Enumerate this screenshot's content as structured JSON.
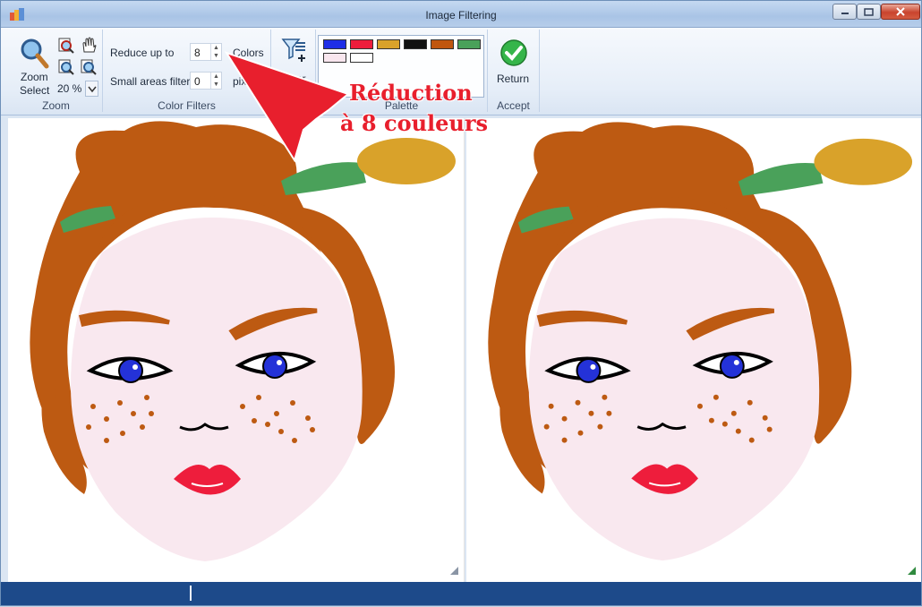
{
  "window": {
    "title": "Image Filtering"
  },
  "ribbon": {
    "zoom": {
      "zoom_select_line1": "Zoom",
      "zoom_select_line2": "Select",
      "zoom_percent": "20 %",
      "group_label": "Zoom"
    },
    "color_filters": {
      "reduce_label": "Reduce up to",
      "reduce_value": "8",
      "colors_label": "Colors",
      "small_areas_label": "Small areas filter",
      "small_areas_value": "0",
      "small_areas_unit": "pix",
      "group_label": "Color Filters"
    },
    "filter": {
      "label": "Filter"
    },
    "palette": {
      "group_label": "Palette",
      "colors": [
        "#1f2ee6",
        "#ee1d3c",
        "#d9a22a",
        "#111111",
        "#c0560f",
        "#4aa15a",
        "#f8e6ee",
        "#ffffff"
      ]
    },
    "accept": {
      "return_label": "Return",
      "group_label": "Accept"
    }
  },
  "annotation": {
    "line1": "Réduction",
    "line2": "à 8 couleurs",
    "color": "#e81f2d"
  },
  "colors": {
    "hair": "#bd5a12",
    "skin": "#f9e8ef",
    "leaf": "#4aa15a",
    "flower": "#d9a22a",
    "iris": "#2432d8",
    "lips": "#ee1d3c",
    "statusbar": "#1d4a8a"
  }
}
